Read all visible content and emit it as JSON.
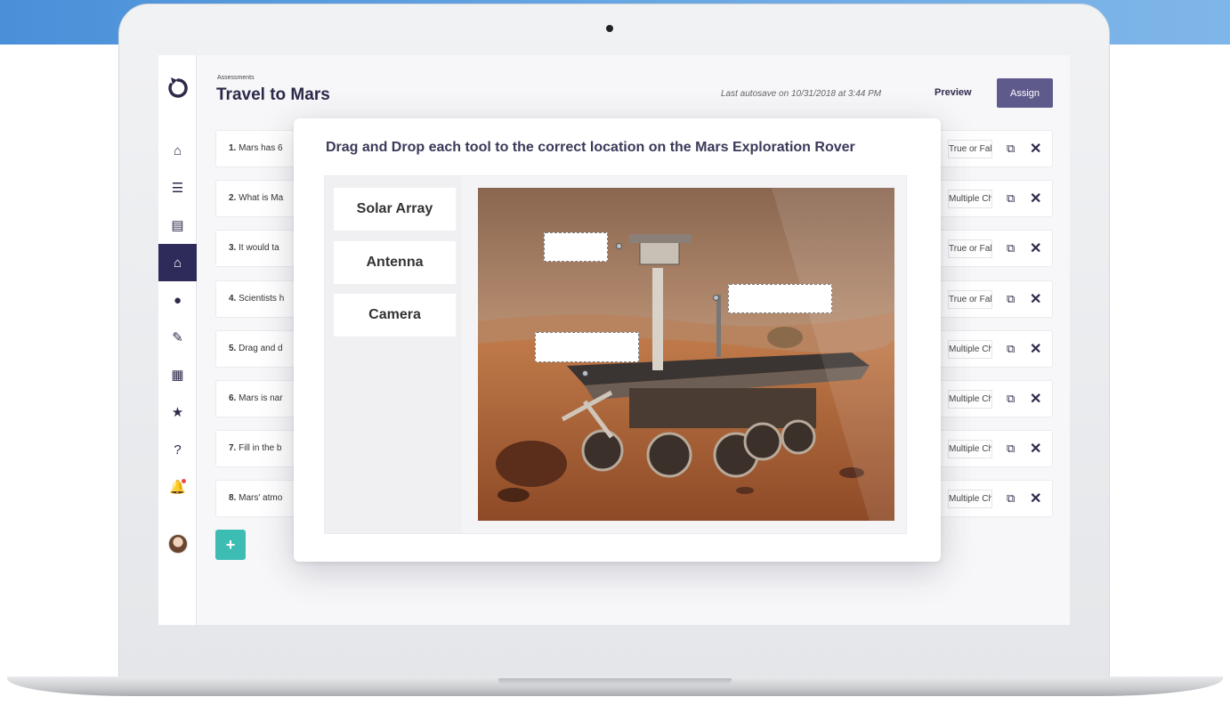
{
  "header": {
    "breadcrumb": "Assessments",
    "title": "Travel to Mars",
    "autosave": "Last autosave on 10/31/2018 at 3:44 PM",
    "preview_label": "Preview",
    "assign_label": "Assign"
  },
  "sidebar": {
    "items": [
      {
        "icon": "home-icon",
        "glyph": "⌂"
      },
      {
        "icon": "list-icon",
        "glyph": "☰"
      },
      {
        "icon": "book-icon",
        "glyph": "▤"
      },
      {
        "icon": "bank-icon",
        "glyph": "⌂"
      },
      {
        "icon": "record-icon",
        "glyph": "●"
      },
      {
        "icon": "pencil-icon",
        "glyph": "✎"
      },
      {
        "icon": "calendar-icon",
        "glyph": "▦"
      },
      {
        "icon": "star-icon",
        "glyph": "★"
      },
      {
        "icon": "help-icon",
        "glyph": "?"
      },
      {
        "icon": "bell-icon",
        "glyph": "🔔"
      }
    ],
    "active_index": 3
  },
  "questions": [
    {
      "number": "1.",
      "text": "Mars has 6",
      "type": "True or False"
    },
    {
      "number": "2.",
      "text": "What is Ma",
      "type": "Multiple Choice"
    },
    {
      "number": "3.",
      "text": "It would ta",
      "type": "True or False"
    },
    {
      "number": "4.",
      "text": "Scientists h",
      "type": "True or False"
    },
    {
      "number": "5.",
      "text": "Drag and d",
      "type": "Multiple Choice"
    },
    {
      "number": "6.",
      "text": "Mars is nar",
      "type": "Multiple Choice"
    },
    {
      "number": "7.",
      "text": "Fill in the b",
      "type": "Multiple Choice"
    },
    {
      "number": "8.",
      "text": "Mars' atmo",
      "type": "Multiple Choice"
    }
  ],
  "add_label": "+",
  "modal": {
    "title": "Drag and Drop each tool to the correct location on the Mars Exploration Rover",
    "tools": [
      "Solar Array",
      "Antenna",
      "Camera"
    ]
  },
  "colors": {
    "primary_dark": "#2e2b5a",
    "assign_button": "#5e5a8c",
    "add_button": "#3dbcb4",
    "sky": "#6aa8e3"
  }
}
